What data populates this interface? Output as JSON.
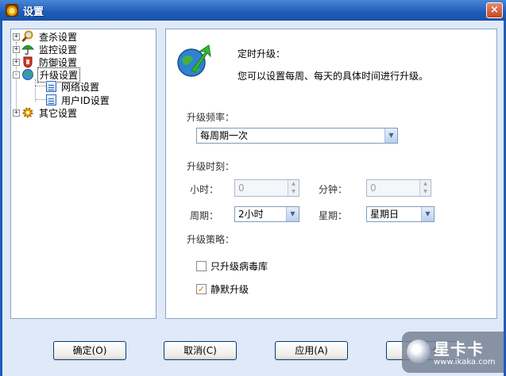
{
  "window": {
    "title": "设置",
    "close_glyph": "×"
  },
  "tree": {
    "items": [
      {
        "label": "查杀设置",
        "icon": "magnifier-icon",
        "expander": "+"
      },
      {
        "label": "监控设置",
        "icon": "umbrella-icon",
        "expander": "+"
      },
      {
        "label": "防御设置",
        "icon": "shield-hand-icon",
        "expander": "+"
      },
      {
        "label": "升级设置",
        "icon": "globe-arrow-icon",
        "expander": "-",
        "selected": true,
        "children": [
          {
            "label": "网络设置"
          },
          {
            "label": "用户ID设置"
          }
        ]
      },
      {
        "label": "其它设置",
        "icon": "gear-icon",
        "expander": "+"
      }
    ]
  },
  "upgrade": {
    "heading": "定时升级：",
    "description": "您可以设置每周、每天的具体时间进行升级。",
    "frequency_label": "升级频率：",
    "frequency_value": "每周期一次",
    "time_label": "升级时刻：",
    "hour_label": "小时：",
    "hour_value": "0",
    "minute_label": "分钟：",
    "minute_value": "0",
    "period_label": "周期：",
    "period_value": "2小时",
    "weekday_label": "星期：",
    "weekday_value": "星期日",
    "strategy_label": "升级策略：",
    "only_virus_db_label": "只升级病毒库",
    "only_virus_db_checked": false,
    "silent_label": "静默升级",
    "silent_checked": true
  },
  "buttons": {
    "ok": "确定(O)",
    "cancel": "取消(C)",
    "apply": "应用(A)",
    "help": "帮助(H)"
  },
  "watermark": {
    "main": "星卡卡",
    "url": "www.ikaka.com"
  },
  "colors": {
    "title_bar": "#1f5cb8",
    "panel_border": "#8aa3c7",
    "accent_green": "#2e9d2e"
  }
}
